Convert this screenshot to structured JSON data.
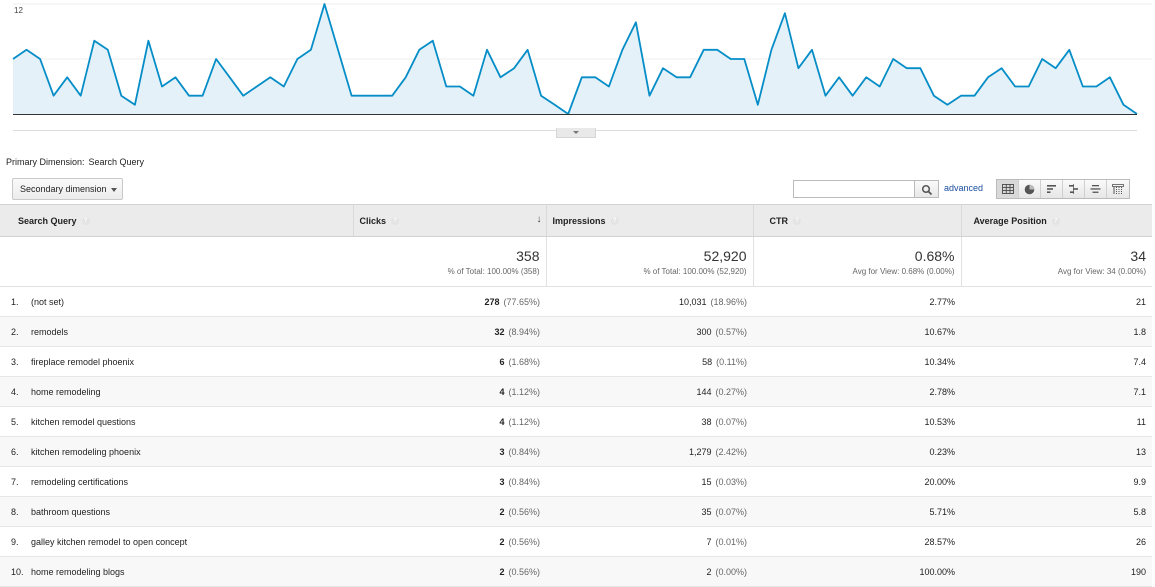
{
  "chart_data": {
    "type": "area",
    "y_ticks": [
      "12",
      "6"
    ],
    "ylim": [
      0,
      12
    ],
    "color": "#058dc7",
    "fill": "#e4f1f8",
    "values": [
      6,
      7,
      6,
      2,
      4,
      2,
      8,
      7,
      2,
      1,
      8,
      3,
      4,
      2,
      2,
      6,
      4,
      2,
      3,
      4,
      3,
      6,
      7,
      12,
      7,
      2,
      2,
      2,
      2,
      4,
      7,
      8,
      3,
      3,
      2,
      7,
      4,
      5,
      7,
      2,
      1,
      0,
      4,
      4,
      3,
      7,
      10,
      2,
      5,
      4,
      4,
      7,
      7,
      6,
      6,
      1,
      7,
      11,
      5,
      7,
      2,
      4,
      2,
      4,
      3,
      6,
      5,
      5,
      2,
      1,
      2,
      2,
      4,
      5,
      3,
      3,
      6,
      5,
      7,
      3,
      3,
      4,
      1,
      0
    ],
    "grid": true
  },
  "primary_dimension": {
    "label": "Primary Dimension:",
    "value": "Search Query"
  },
  "secondary_dimension": {
    "label": "Secondary dimension"
  },
  "search": {
    "value": "",
    "advanced_label": "advanced"
  },
  "columns": {
    "query": "Search Query",
    "clicks": "Clicks",
    "impressions": "Impressions",
    "ctr": "CTR",
    "position": "Average Position",
    "help": "?",
    "sort_arrow": "↓"
  },
  "totals": {
    "clicks": "358",
    "clicks_sub": "% of Total: 100.00% (358)",
    "impressions": "52,920",
    "impressions_sub": "% of Total: 100.00% (52,920)",
    "ctr": "0.68%",
    "ctr_sub": "Avg for View: 0.68% (0.00%)",
    "position": "34",
    "position_sub": "Avg for View: 34 (0.00%)"
  },
  "rows": [
    {
      "n": "1.",
      "query": "(not set)",
      "clicks": "278",
      "clicks_pct": "(77.65%)",
      "impr": "10,031",
      "impr_pct": "(18.96%)",
      "ctr": "2.77%",
      "pos": "21"
    },
    {
      "n": "2.",
      "query": "remodels",
      "clicks": "32",
      "clicks_pct": "(8.94%)",
      "impr": "300",
      "impr_pct": "(0.57%)",
      "ctr": "10.67%",
      "pos": "1.8"
    },
    {
      "n": "3.",
      "query": "fireplace remodel phoenix",
      "clicks": "6",
      "clicks_pct": "(1.68%)",
      "impr": "58",
      "impr_pct": "(0.11%)",
      "ctr": "10.34%",
      "pos": "7.4"
    },
    {
      "n": "4.",
      "query": "home remodeling",
      "clicks": "4",
      "clicks_pct": "(1.12%)",
      "impr": "144",
      "impr_pct": "(0.27%)",
      "ctr": "2.78%",
      "pos": "7.1"
    },
    {
      "n": "5.",
      "query": "kitchen remodel questions",
      "clicks": "4",
      "clicks_pct": "(1.12%)",
      "impr": "38",
      "impr_pct": "(0.07%)",
      "ctr": "10.53%",
      "pos": "11"
    },
    {
      "n": "6.",
      "query": "kitchen remodeling phoenix",
      "clicks": "3",
      "clicks_pct": "(0.84%)",
      "impr": "1,279",
      "impr_pct": "(2.42%)",
      "ctr": "0.23%",
      "pos": "13"
    },
    {
      "n": "7.",
      "query": "remodeling certifications",
      "clicks": "3",
      "clicks_pct": "(0.84%)",
      "impr": "15",
      "impr_pct": "(0.03%)",
      "ctr": "20.00%",
      "pos": "9.9"
    },
    {
      "n": "8.",
      "query": "bathroom questions",
      "clicks": "2",
      "clicks_pct": "(0.56%)",
      "impr": "35",
      "impr_pct": "(0.07%)",
      "ctr": "5.71%",
      "pos": "5.8"
    },
    {
      "n": "9.",
      "query": "galley kitchen remodel to open concept",
      "clicks": "2",
      "clicks_pct": "(0.56%)",
      "impr": "7",
      "impr_pct": "(0.01%)",
      "ctr": "28.57%",
      "pos": "26"
    },
    {
      "n": "10.",
      "query": "home remodeling blogs",
      "clicks": "2",
      "clicks_pct": "(0.56%)",
      "impr": "2",
      "impr_pct": "(0.00%)",
      "ctr": "100.00%",
      "pos": "190"
    }
  ]
}
